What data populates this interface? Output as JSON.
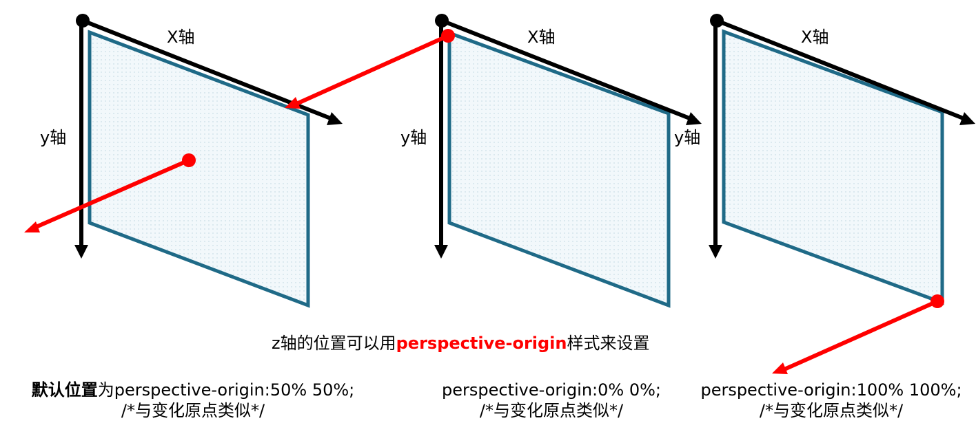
{
  "diagram": {
    "panels": [
      {
        "x_label": "X轴",
        "y_label": "y轴",
        "y_label_right": ""
      },
      {
        "x_label": "X轴",
        "y_label": "y轴",
        "y_label_right": "y轴"
      },
      {
        "x_label": "X轴",
        "y_label": "",
        "y_label_right": ""
      }
    ],
    "colors": {
      "axis": "#000000",
      "plane_stroke": "#1f6a87",
      "plane_fill": "#f2f8fb",
      "origin_marker": "#ff0000"
    },
    "center_caption": {
      "prefix": "z轴的位置可以用",
      "highlight": "perspective-origin",
      "suffix": "样式来设置"
    },
    "captions": [
      {
        "bold": "默认位置",
        "line1": "为perspective-origin:50% 50%;",
        "line2": "/*与变化原点类似*/"
      },
      {
        "bold": "",
        "line1": "perspective-origin:0% 0%;",
        "line2": "/*与变化原点类似*/"
      },
      {
        "bold": "",
        "line1": "perspective-origin:100% 100%;",
        "line2": "/*与变化原点类似*/"
      }
    ]
  }
}
